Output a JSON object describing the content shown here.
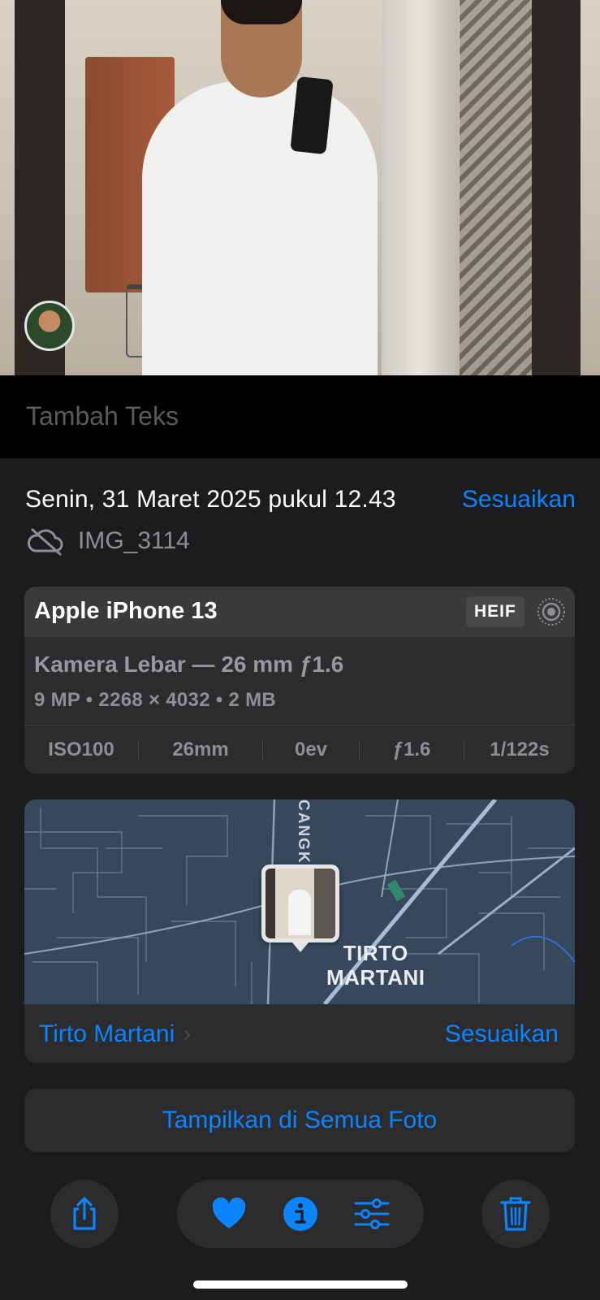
{
  "photo": {
    "description_icon": "photo-subject",
    "avatar_icon": "face-avatar"
  },
  "caption": {
    "placeholder": "Tambah Teks"
  },
  "info": {
    "date": "Senin, 31 Maret 2025 pukul 12.43",
    "adjust_label": "Sesuaikan",
    "file_name": "IMG_3114",
    "file_icon": "cloud-off-icon"
  },
  "camera": {
    "device": "Apple iPhone 13",
    "format_badge": "HEIF",
    "live_icon": "live-photo-icon",
    "lens": "Kamera Lebar — 26 mm ƒ1.6",
    "specs": "9 MP • 2268 × 4032 • 2 MB",
    "exif": [
      "ISO100",
      "26mm",
      "0ev",
      "ƒ1.6",
      "1/122s"
    ]
  },
  "map": {
    "street_label": "CANGK",
    "place_label_line1": "TIRTO",
    "place_label_line2": "MARTANI",
    "location_link": "Tirto Martani",
    "adjust_label": "Sesuaikan"
  },
  "actions": {
    "show_all": "Tampilkan di Semua Foto"
  },
  "toolbar": {
    "share_icon": "share-icon",
    "favorite_icon": "heart-icon",
    "info_icon": "info-icon",
    "edit_icon": "adjust-sliders-icon",
    "delete_icon": "trash-icon"
  },
  "colors": {
    "accent": "#0a84ff",
    "background": "#1c1c1e",
    "card": "#2c2c2e"
  }
}
